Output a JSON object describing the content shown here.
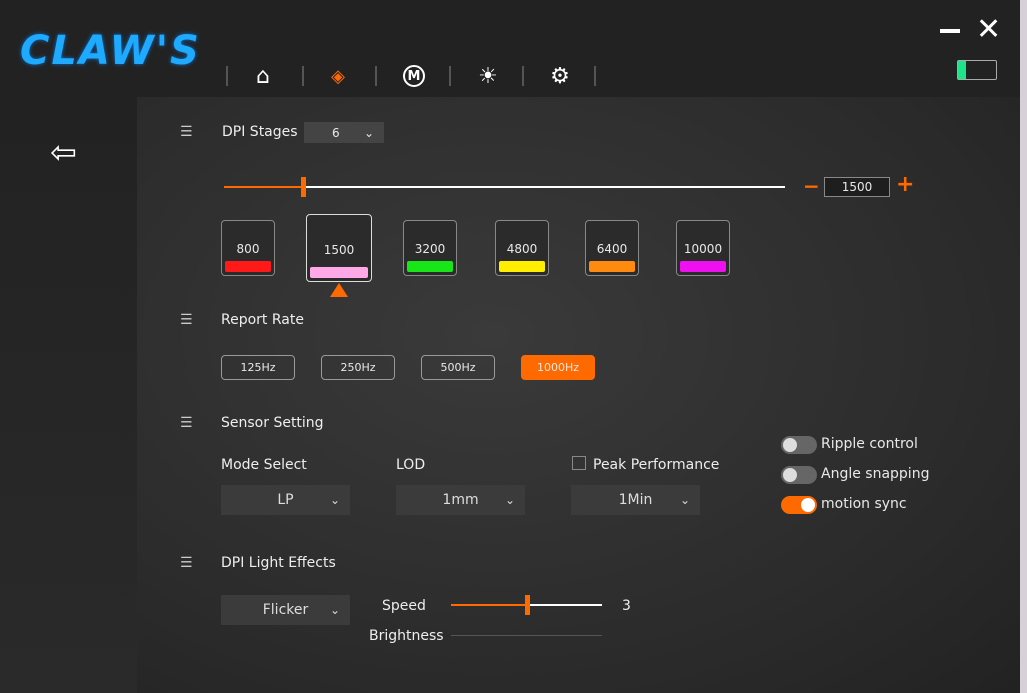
{
  "header": {
    "logo": "CLAW'S",
    "nav": [
      {
        "icon": "home-icon"
      },
      {
        "icon": "dpi-icon",
        "active": true
      },
      {
        "icon": "macro-icon",
        "label": "M"
      },
      {
        "icon": "light-icon"
      },
      {
        "icon": "settings-icon"
      }
    ],
    "battery_level": 0.2
  },
  "colors": {
    "accent": "#ff6a00",
    "logo": "#1eaaff",
    "battery": "#1de38a"
  },
  "dpi": {
    "title": "DPI Stages",
    "stages_count": "6",
    "slider_value": "1500",
    "slider_fraction": 0.14,
    "minus": "−",
    "plus": "+",
    "stages": [
      {
        "value": "800",
        "color": "#ff1a1a"
      },
      {
        "value": "1500",
        "color": "#ffa8e8",
        "selected": true
      },
      {
        "value": "3200",
        "color": "#19e619"
      },
      {
        "value": "4800",
        "color": "#ffee00"
      },
      {
        "value": "6400",
        "color": "#ff8a10"
      },
      {
        "value": "10000",
        "color": "#ee10ee"
      }
    ]
  },
  "report": {
    "title": "Report Rate",
    "rates": [
      {
        "label": "125Hz"
      },
      {
        "label": "250Hz"
      },
      {
        "label": "500Hz"
      },
      {
        "label": "1000Hz",
        "active": true
      }
    ]
  },
  "sensor": {
    "title": "Sensor Setting",
    "mode_label": "Mode Select",
    "mode_value": "LP",
    "lod_label": "LOD",
    "lod_value": "1mm",
    "peak_label": "Peak Performance",
    "peak_value": "1Min",
    "toggles": [
      {
        "label": "Ripple control",
        "on": false
      },
      {
        "label": "Angle snapping",
        "on": false
      },
      {
        "label": "motion sync",
        "on": true
      }
    ]
  },
  "light": {
    "title": "DPI Light Effects",
    "effect": "Flicker",
    "speed_label": "Speed",
    "speed_value": "3",
    "speed_fraction": 0.5,
    "brightness_label": "Brightness"
  }
}
